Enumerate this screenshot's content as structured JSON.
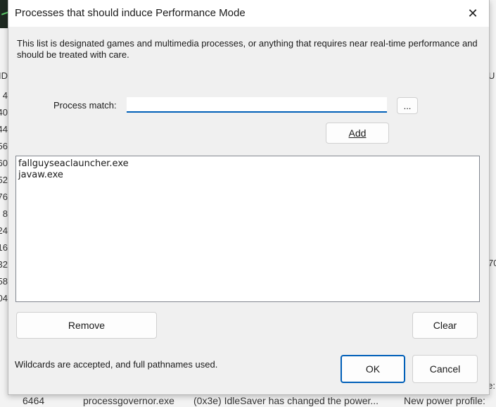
{
  "background": {
    "left_fragments": [
      "ID",
      "4",
      "40",
      "44",
      "56",
      "60",
      "52",
      "76",
      "8",
      "24",
      "16",
      "32",
      "58",
      "04"
    ],
    "right_fragments": [
      "U",
      "70"
    ],
    "bottom_fragments": [
      "6464",
      "processgovernor.exe",
      "(0x3e) IdleSaver has changed the power...",
      "New power profile:"
    ],
    "right_edge_text": "e:"
  },
  "dialog": {
    "title": "Processes that should induce Performance Mode",
    "close_glyph": "✕",
    "description": "This list is designated games and multimedia processes, or anything that requires near real-time performance and should be treated with care.",
    "process_match_label": "Process match:",
    "process_match_value": "",
    "browse_label": "...",
    "add_label": "Add",
    "list_items": [
      "fallguyseaclauncher.exe",
      "javaw.exe"
    ],
    "remove_label": "Remove",
    "clear_label": "Clear",
    "note": "Wildcards are accepted, and full pathnames used.",
    "ok_label": "OK",
    "cancel_label": "Cancel"
  },
  "colors": {
    "accent": "#005fb8",
    "dialog_bg": "#f0f0f0",
    "titlebar_bg": "#ffffff"
  }
}
